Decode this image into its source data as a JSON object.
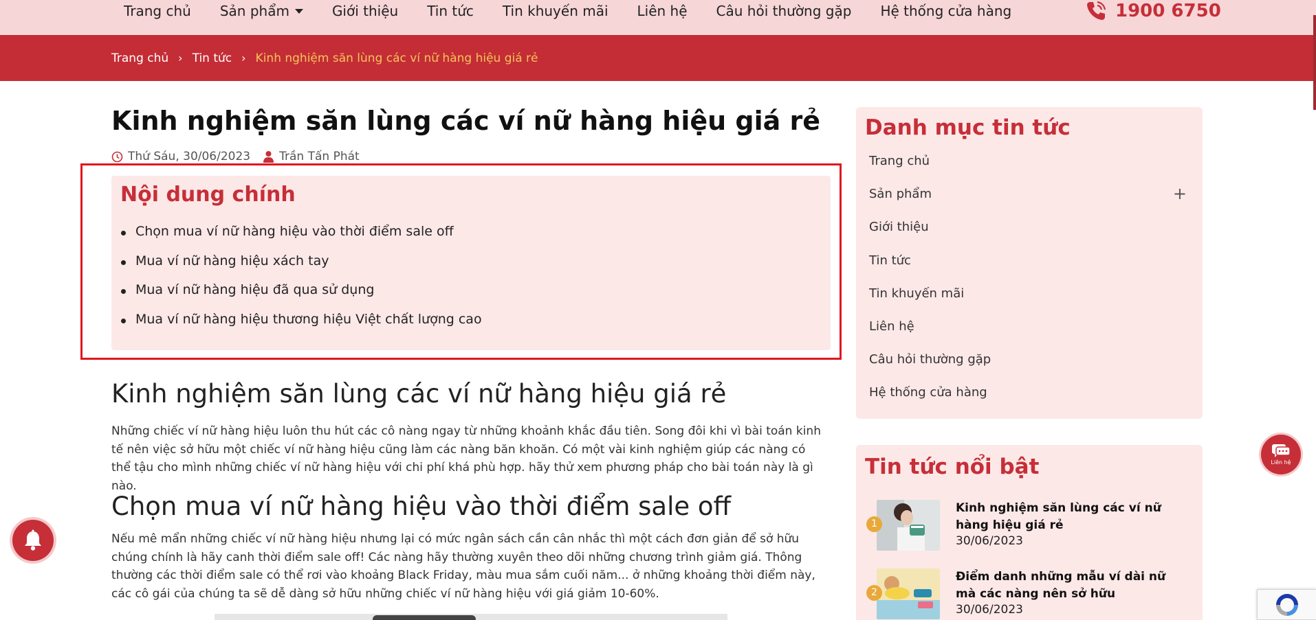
{
  "nav": {
    "items": [
      "Trang chủ",
      "Sản phẩm",
      "Giới thiệu",
      "Tin tức",
      "Tin khuyến mãi",
      "Liên hệ",
      "Câu hỏi thường gặp",
      "Hệ thống cửa hàng"
    ],
    "hotline": "1900 6750"
  },
  "breadcrumb": {
    "home": "Trang chủ",
    "section": "Tin tức",
    "current": "Kinh nghiệm săn lùng các ví nữ hàng hiệu giá rẻ"
  },
  "article": {
    "title": "Kinh nghiệm săn lùng các ví nữ hàng hiệu giá rẻ",
    "date": "Thứ Sáu, 30/06/2023",
    "author": "Trần Tấn Phát",
    "toc_title": "Nội dung chính",
    "toc_items": [
      "Chọn mua ví nữ hàng hiệu vào thời điểm sale off",
      "Mua ví nữ hàng hiệu xách tay",
      "Mua ví nữ hàng hiệu đã qua sử dụng",
      "Mua ví nữ hàng hiệu thương hiệu Việt chất lượng cao"
    ],
    "heading_1": "Kinh nghiệm săn lùng các ví nữ hàng hiệu giá rẻ",
    "paragraph_1": "Những chiếc ví nữ hàng hiệu luôn thu hút các cô nàng ngay từ những khoảnh khắc đầu tiên. Song đôi khi vì bài toán kinh tế nên việc sở hữu một chiếc ví nữ hàng hiệu cũng làm các nàng băn khoăn. Có một vài kinh nghiệm giúp các nàng có thể tậu cho mình những chiếc ví nữ hàng hiệu với chi phí khá phù hợp. hãy thử xem phương pháp cho bài toán này là gì nào.",
    "heading_2": "Chọn mua ví nữ hàng hiệu vào thời điểm sale off",
    "paragraph_2": "Nếu mê mẩn những chiếc ví nữ hàng hiệu nhưng lại có mức ngân sách cần cân nhắc thì một cách đơn giản để sở hữu chúng chính là hãy canh thời điểm sale off! Các nàng hãy thường xuyên theo dõi những chương trình giảm giá. Thông thường các thời điểm sale có thể rơi vào khoảng Black Friday, màu mua sắm cuối năm... ở những khoảng thời điểm này, các cô gái của chúng ta sẽ dễ dàng sở hữu những chiếc ví nữ hàng hiệu với giá giảm 10-60%."
  },
  "sidebar": {
    "categories_title": "Danh mục tin tức",
    "categories": [
      "Trang chủ",
      "Sản phẩm",
      "Giới thiệu",
      "Tin tức",
      "Tin khuyến mãi",
      "Liên hệ",
      "Câu hỏi thường gặp",
      "Hệ thống cửa hàng"
    ],
    "expand_symbol": "+",
    "featured_title": "Tin tức nổi bật",
    "featured": [
      {
        "rank": "1",
        "title": "Kinh nghiệm săn lùng các ví nữ hàng hiệu giá rẻ",
        "date": "30/06/2023"
      },
      {
        "rank": "2",
        "title": "Điểm danh những mẫu ví dài nữ mà các nàng nên sở hữu",
        "date": "30/06/2023"
      }
    ]
  },
  "widgets": {
    "chat_label": "Liên hệ"
  },
  "colors": {
    "brand_red": "#c62f38",
    "breadcrumb_bg": "#c42d36",
    "nav_bg": "#f7d6d8",
    "panel_bg": "#fde8e8",
    "highlight_border": "#e0161f",
    "breadcrumb_current": "#f4c45b",
    "rank_badge": "#e8a93a"
  },
  "icons": [
    "phone-icon",
    "chevron-right-icon",
    "clock-icon",
    "user-icon",
    "plus-icon",
    "bell-icon",
    "chat-icon",
    "recaptcha-icon"
  ]
}
